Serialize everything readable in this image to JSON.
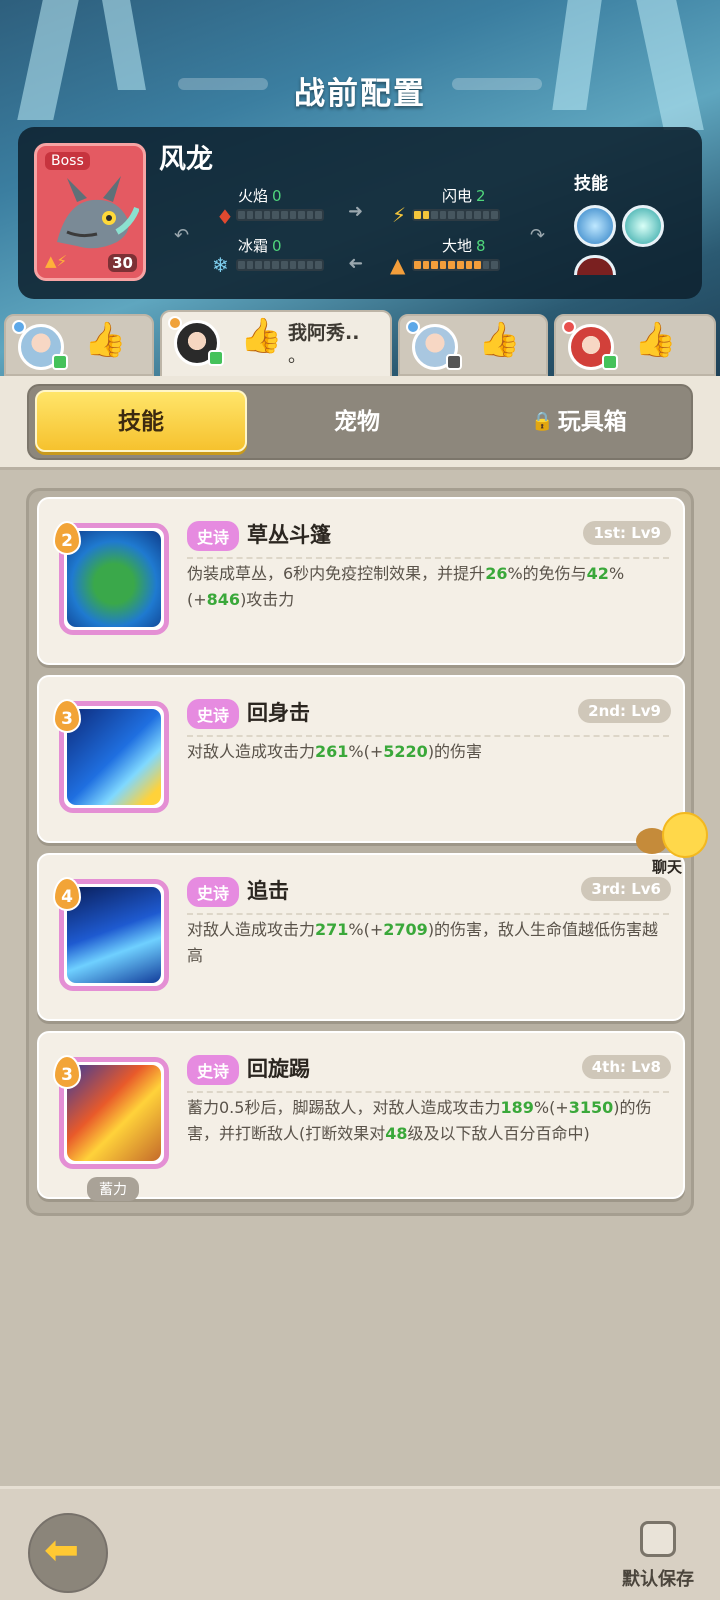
{
  "header": {
    "title": "战前配置"
  },
  "boss": {
    "tag": "Boss",
    "name": "风龙",
    "level": "30",
    "skills_label": "技能",
    "stats": [
      {
        "label": "火焰",
        "value": "0",
        "icon": "fire-icon",
        "filled": 0,
        "total": 10
      },
      {
        "label": "闪电",
        "value": "2",
        "icon": "lightning-icon",
        "filled": 2,
        "total": 10
      },
      {
        "label": "冰霜",
        "value": "0",
        "icon": "snowflake-icon",
        "filled": 0,
        "total": 10
      },
      {
        "label": "大地",
        "value": "8",
        "icon": "earth-icon",
        "filled": 8,
        "total": 10
      }
    ]
  },
  "players": [
    {
      "name": "",
      "active": false
    },
    {
      "name": "我阿秀..",
      "name2": "。",
      "active": true
    },
    {
      "name": "",
      "active": false
    },
    {
      "name": "",
      "active": false
    }
  ],
  "tabs": {
    "skills": "技能",
    "pets": "宠物",
    "toybox": "玩具箱"
  },
  "skills": [
    {
      "num": "2",
      "rarity": "史诗",
      "name": "草丛斗篷",
      "slot": "1st: Lv9",
      "desc": [
        {
          "t": "伪装成草丛，6秒内免疫控制效果，并提升"
        },
        {
          "t": "26",
          "g": true
        },
        {
          "t": "%的免伤与"
        },
        {
          "t": "42",
          "g": true
        },
        {
          "t": "%(+"
        },
        {
          "t": "846",
          "g": true
        },
        {
          "t": ")攻击力"
        }
      ]
    },
    {
      "num": "3",
      "rarity": "史诗",
      "name": "回身击",
      "slot": "2nd: Lv9",
      "desc": [
        {
          "t": "对敌人造成攻击力"
        },
        {
          "t": "261",
          "g": true
        },
        {
          "t": "%(+"
        },
        {
          "t": "5220",
          "g": true
        },
        {
          "t": ")的伤害"
        }
      ]
    },
    {
      "num": "4",
      "rarity": "史诗",
      "name": "追击",
      "slot": "3rd: Lv6",
      "desc": [
        {
          "t": "对敌人造成攻击力"
        },
        {
          "t": "271",
          "g": true
        },
        {
          "t": "%(+"
        },
        {
          "t": "2709",
          "g": true
        },
        {
          "t": ")的伤害，敌人生命值越低伤害越高"
        }
      ]
    },
    {
      "num": "3",
      "rarity": "史诗",
      "name": "回旋踢",
      "slot": "4th: Lv8",
      "tag": "蓄力",
      "desc": [
        {
          "t": "蓄力0.5秒后，脚踢敌人，对敌人造成攻击力"
        },
        {
          "t": "189",
          "g": true
        },
        {
          "t": "%(+"
        },
        {
          "t": "3150",
          "g": true
        },
        {
          "t": ")的伤害，并打断敌人(打断效果对"
        },
        {
          "t": "48",
          "g": true
        },
        {
          "t": "级及以下敌人百分百命中)"
        }
      ]
    }
  ],
  "chat": {
    "label": "聊天"
  },
  "footer": {
    "save_label": "默认保存"
  }
}
